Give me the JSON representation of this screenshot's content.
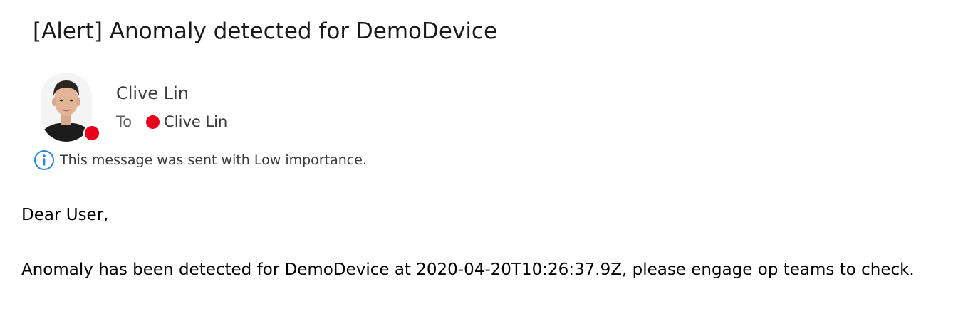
{
  "email": {
    "subject": "[Alert] Anomaly detected for DemoDevice",
    "sender": {
      "name": "Clive Lin",
      "avatar_icon": "person-photo",
      "presence_color": "#e8001c"
    },
    "recipients": {
      "to_label": "To",
      "list": [
        {
          "name": "Clive Lin",
          "presence_color": "#e8001c"
        }
      ]
    },
    "importance": {
      "icon": "info-icon",
      "text": "This message was sent with Low importance."
    },
    "body": {
      "greeting": "Dear User,",
      "message": "Anomaly has been detected for DemoDevice at 2020-04-20T10:26:37.9Z, please engage op teams to check."
    }
  }
}
